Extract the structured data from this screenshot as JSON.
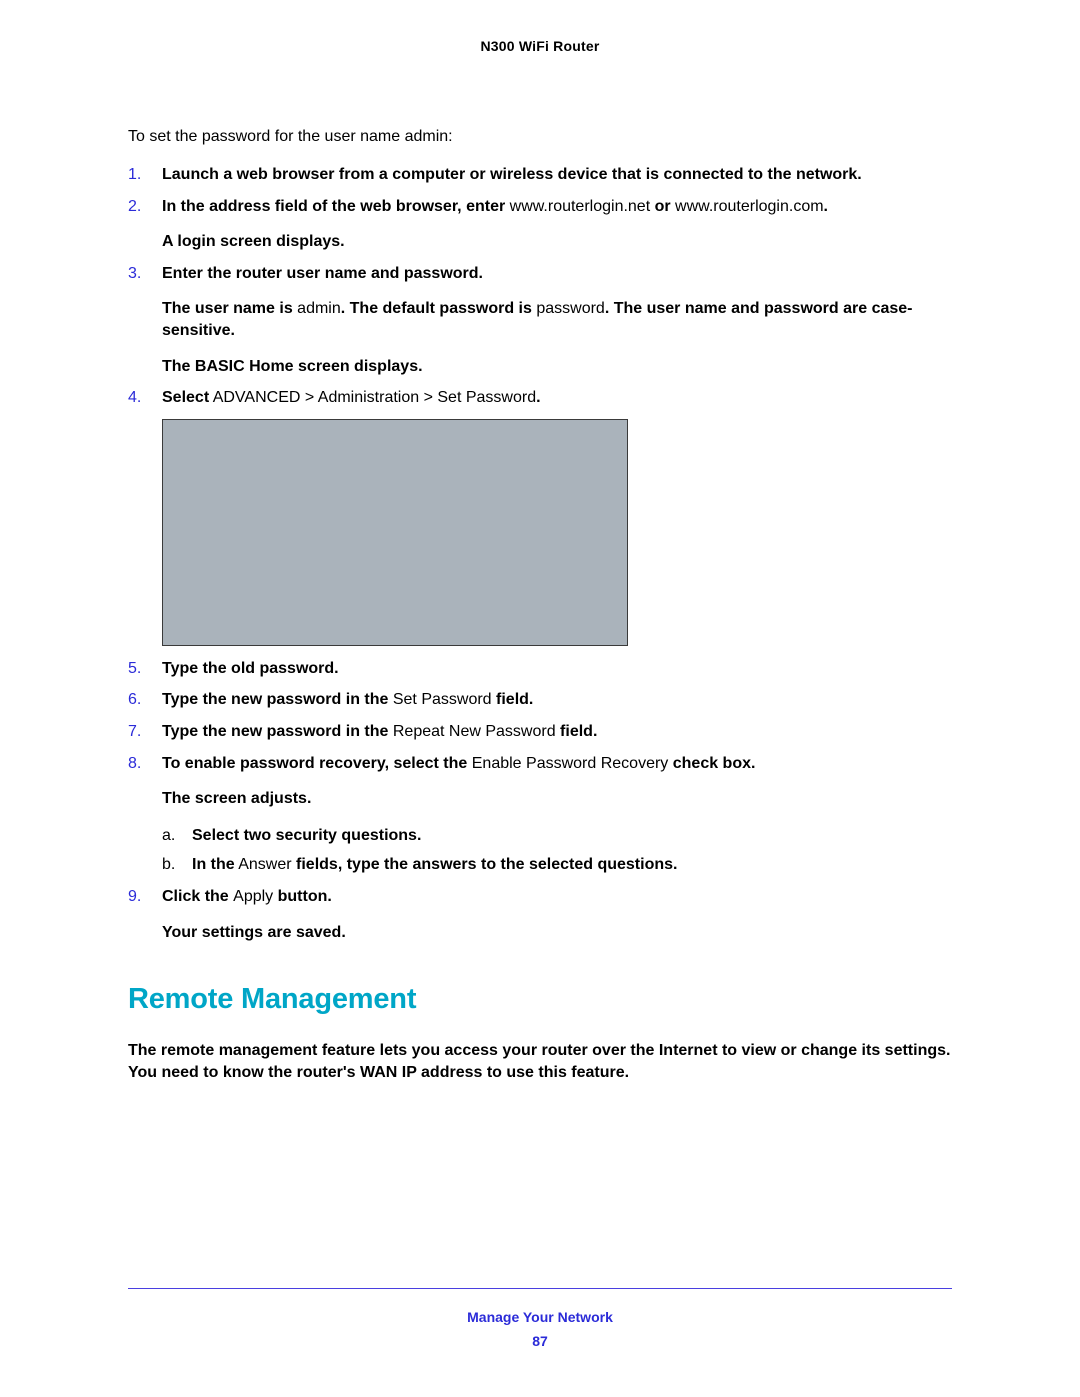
{
  "header": {
    "product_title": "N300 WiFi Router"
  },
  "intro": "To set the password for the user name admin:",
  "steps": {
    "s1": {
      "num": "1.",
      "text": "Launch a web browser from a computer or wireless device that is connected to the network."
    },
    "s2": {
      "num": "2.",
      "a": "In the address field of the web browser, ",
      "b": "enter",
      "c": " www.routerlogin.net ",
      "d": "or",
      "e": " www.routerlogin.com",
      "f": ".",
      "para": "A login screen displays."
    },
    "s3": {
      "num": "3.",
      "a": "Enter the router ",
      "b": "user name and password.",
      "p1a": "The user name is ",
      "p1b": "admin",
      "p1c": ". The default password is",
      "p1d": " password",
      "p1e": ". The user name and password are case-sensitive.",
      "p2": "The BASIC Home screen displays."
    },
    "s4": {
      "num": "4.",
      "a": "Select",
      "b": " ADVANCED > Administration > Set Password",
      "c": "."
    },
    "s5": {
      "num": "5.",
      "text": "Type the old password."
    },
    "s6": {
      "num": "6.",
      "a": "Type the new password in the ",
      "b": "Set Password",
      "c": " field."
    },
    "s7": {
      "num": "7.",
      "a": "Type the new password in the ",
      "b": "Repeat New Password",
      "c": " field."
    },
    "s8": {
      "num": "8.",
      "a": "To enable password recovery, select the ",
      "b": "Enable Password Recovery",
      "c": " check box.",
      "p1": "The screen adjusts.",
      "sa": {
        "letter": "a.",
        "text": "Select two security questions."
      },
      "sb": {
        "letter": "b.",
        "a": "In the",
        "b": " Answer ",
        "c": "fields, type the answers to the selected questions."
      }
    },
    "s9": {
      "num": "9.",
      "a": "Click the ",
      "b": "Apply",
      "c": " button.",
      "p1": "Your settings are saved."
    }
  },
  "section": {
    "heading": "Remote Management",
    "desc": "The remote management feature lets you access your router over the Internet to view or change its settings. You need to know the router's WAN IP address to use this feature."
  },
  "footer": {
    "section_label": "Manage Your Network",
    "page_number": "87"
  }
}
